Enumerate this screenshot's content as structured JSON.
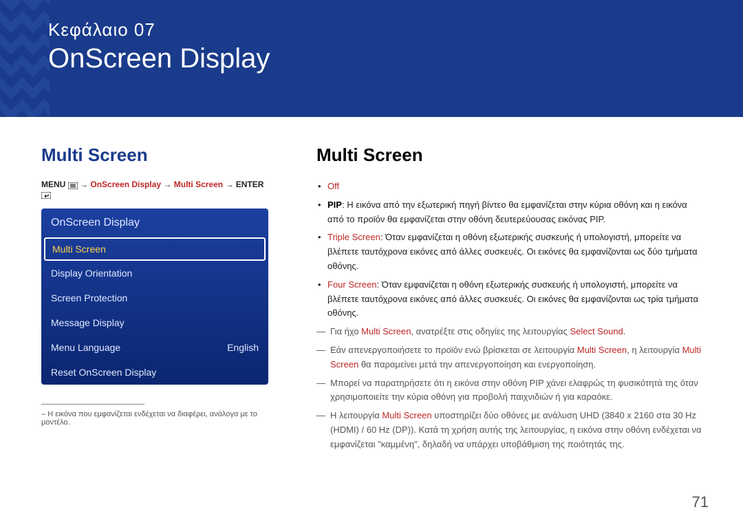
{
  "header": {
    "chapter_label": "Κεφάλαιο  07",
    "chapter_title": "OnScreen Display"
  },
  "left": {
    "heading": "Multi Screen",
    "breadcrumb": {
      "p1": "MENU",
      "p2": "OnScreen Display",
      "p3": "Multi Screen",
      "p4": "ENTER"
    },
    "menu": {
      "title": "OnScreen Display",
      "items": [
        {
          "label": "Multi Screen",
          "value": "",
          "selected": true
        },
        {
          "label": "Display Orientation",
          "value": "",
          "selected": false
        },
        {
          "label": "Screen Protection",
          "value": "",
          "selected": false
        },
        {
          "label": "Message Display",
          "value": "",
          "selected": false
        },
        {
          "label": "Menu Language",
          "value": "English",
          "selected": false
        },
        {
          "label": "Reset OnScreen Display",
          "value": "",
          "selected": false
        }
      ]
    },
    "footnote_prefix": "–  ",
    "footnote": "Η εικόνα που εμφανίζεται ενδέχεται να διαφέρει, ανάλογα με το μοντέλο."
  },
  "right": {
    "heading": "Multi Screen",
    "bullets": {
      "b0_hl": "Off",
      "b1_bold": "PIP",
      "b1_text": ": Η εικόνα από την εξωτερική πηγή βίντεο θα εμφανίζεται στην κύρια οθόνη και η εικόνα από το προϊόν θα εμφανίζεται στην οθόνη δευτερεύουσας εικόνας PIP.",
      "b2_hl": "Triple Screen",
      "b2_text": ": Όταν εμφανίζεται η οθόνη εξωτερικής συσκευής ή υπολογιστή, μπορείτε να βλέπετε ταυτόχρονα εικόνες από άλλες συσκευές. Οι εικόνες θα εμφανίζονται ως δύο τμήματα οθόνης.",
      "b3_hl": "Four Screen",
      "b3_text": ": Όταν εμφανίζεται η οθόνη εξωτερικής συσκευής ή υπολογιστή, μπορείτε να βλέπετε ταυτόχρονα εικόνες από άλλες συσκευές. Οι εικόνες θα εμφανίζονται ως τρία τμήματα οθόνης."
    },
    "dashes": {
      "d0_a": "Για ήχο ",
      "d0_hl1": "Multi Screen",
      "d0_b": ", ανατρέξτε στις οδηγίες της λειτουργίας ",
      "d0_hl2": "Select Sound",
      "d0_c": ".",
      "d1_a": "Εάν απενεργοποιήσετε το προϊόν ενώ βρίσκεται σε λειτουργία ",
      "d1_hl1": "Multi Screen",
      "d1_b": ", η λειτουργία ",
      "d1_hl2": "Multi Screen",
      "d1_c": " θα παραμείνει μετά την απενεργοποίηση και ενεργοποίηση.",
      "d2": "Μπορεί να παρατηρήσετε ότι η εικόνα στην οθόνη PIP χάνει ελαφρώς τη φυσικότητά της όταν χρησιμοποιείτε την κύρια οθόνη για προβολή παιχνιδιών ή για καραόκε.",
      "d3_a": "Η λειτουργία ",
      "d3_hl": "Multi Screen",
      "d3_b": " υποστηρίζει δύο οθόνες με ανάλυση UHD (3840 x 2160 στα 30 Hz (HDMI) / 60 Hz (DP)). Κατά τη χρήση αυτής της λειτουργίας, η εικόνα στην οθόνη ενδέχεται να εμφανίζεται \"καμμένη\", δηλαδή να υπάρχει υποβάθμιση της ποιότητάς της."
    }
  },
  "page_number": "71"
}
